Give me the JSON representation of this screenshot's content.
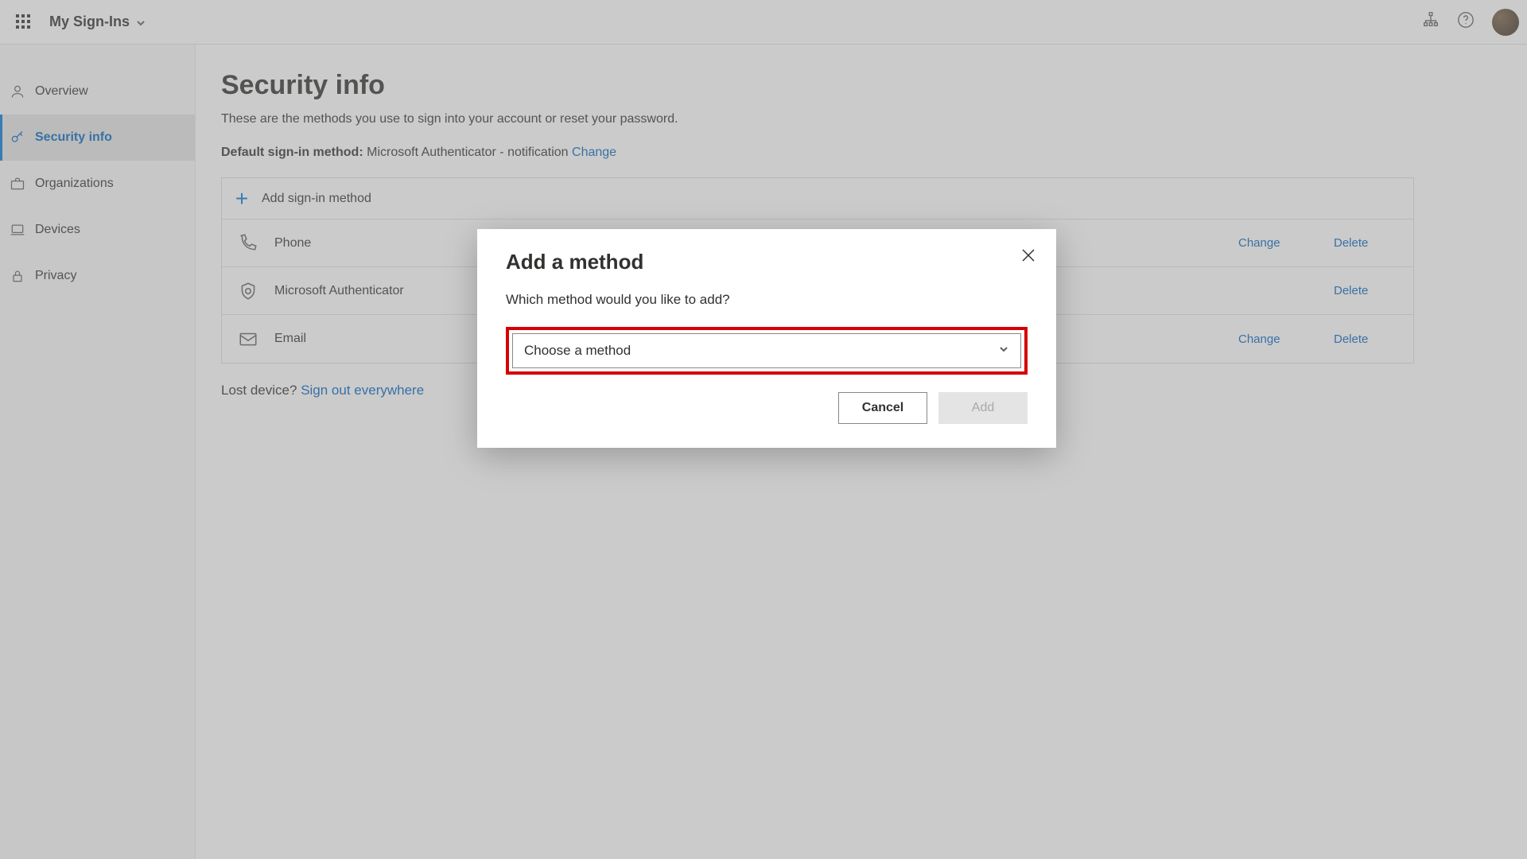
{
  "header": {
    "brand": "My Sign-Ins"
  },
  "sidebar": {
    "items": [
      {
        "label": "Overview"
      },
      {
        "label": "Security info"
      },
      {
        "label": "Organizations"
      },
      {
        "label": "Devices"
      },
      {
        "label": "Privacy"
      }
    ]
  },
  "page": {
    "title": "Security info",
    "subtitle": "These are the methods you use to sign into your account or reset your password.",
    "default_method_prefix": "Default sign-in method:",
    "default_method_value": " Microsoft Authenticator - notification ",
    "change_link": "Change",
    "add_method_label": "Add sign-in method",
    "methods": [
      {
        "label": "Phone",
        "value": "",
        "change": "Change",
        "delete": "Delete"
      },
      {
        "label": "Microsoft Authenticator",
        "value": "",
        "change": "",
        "delete": "Delete"
      },
      {
        "label": "Email",
        "value": "",
        "change": "Change",
        "delete": "Delete"
      }
    ],
    "lost_device_prefix": "Lost device? ",
    "lost_device_link": "Sign out everywhere"
  },
  "modal": {
    "title": "Add a method",
    "question": "Which method would you like to add?",
    "select_placeholder": "Choose a method",
    "cancel_label": "Cancel",
    "add_label": "Add"
  }
}
